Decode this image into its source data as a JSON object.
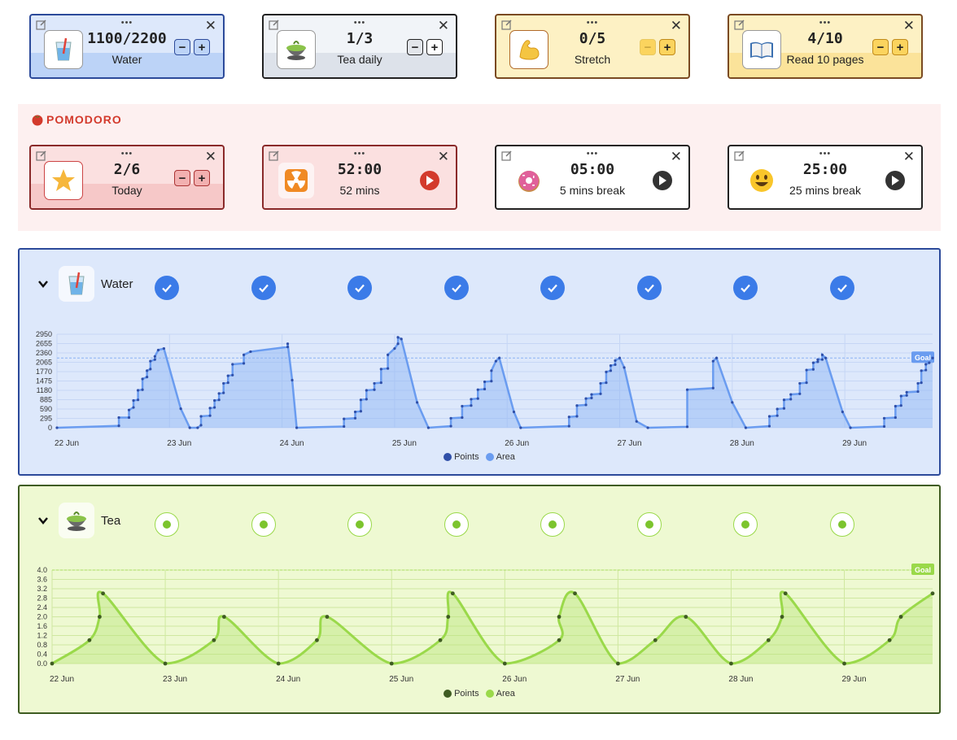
{
  "habits": [
    {
      "value": "1100/2200",
      "label": "Water",
      "icon": "water-glass-icon",
      "theme": "blue",
      "fill": 0.5
    },
    {
      "value": "1/3",
      "label": "Tea daily",
      "icon": "tea-bowl-icon",
      "theme": "gray",
      "fill": 0.33
    },
    {
      "value": "0/5",
      "label": "Stretch",
      "icon": "flexed-arm-icon",
      "theme": "yellow",
      "fill": 0
    },
    {
      "value": "4/10",
      "label": "Read 10 pages",
      "icon": "open-book-icon",
      "theme": "yellow",
      "fill": 0.4
    }
  ],
  "pomodoro": {
    "title": "POMODORO",
    "title_icon": "tomato-icon",
    "cards": [
      {
        "value": "2/6",
        "label": "Today",
        "icon": "star-icon",
        "theme": "red",
        "kind": "counter",
        "fill": 0.33
      },
      {
        "value": "52:00",
        "label": "52 mins",
        "icon": "radioactive-icon",
        "theme": "red",
        "kind": "timer"
      },
      {
        "value": "05:00",
        "label": "5 mins break",
        "icon": "donut-icon",
        "theme": "white",
        "kind": "timer"
      },
      {
        "value": "25:00",
        "label": "25 mins break",
        "icon": "smiley-icon",
        "theme": "white",
        "kind": "timer"
      }
    ]
  },
  "colors": {
    "blue_border": "#2c4a9a",
    "blue_bg": "#dde8fb",
    "blue_line": "#6a9cf0",
    "blue_point": "#2f4fa8",
    "green_border": "#3f5c22",
    "green_bg": "#eef9d2",
    "green_line": "#9ad94a",
    "green_point": "#3f5c22",
    "red": "#d33a2c"
  },
  "water_panel": {
    "name": "Water",
    "icon": "water-glass-icon",
    "day_status": [
      "done",
      "done",
      "done",
      "done",
      "done",
      "done",
      "done",
      "done"
    ],
    "goal_label": "Goal",
    "chart_data": {
      "type": "area",
      "x_tick_labels": [
        "22 Jun",
        "23 Jun",
        "24 Jun",
        "25 Jun",
        "26 Jun",
        "27 Jun",
        "28 Jun",
        "29 Jun"
      ],
      "y_tick_labels": [
        "0",
        "295",
        "590",
        "885",
        "1180",
        "1475",
        "1770",
        "2065",
        "2360",
        "2655",
        "2950"
      ],
      "ylim": [
        0,
        2950
      ],
      "xlim": [
        0,
        7.78
      ],
      "goal": 2200,
      "legend": [
        "Points",
        "Area"
      ],
      "series": [
        {
          "name": "Area",
          "points": [
            [
              0,
              0
            ],
            [
              0.55,
              60
            ],
            [
              0.55,
              320
            ],
            [
              0.64,
              320
            ],
            [
              0.64,
              560
            ],
            [
              0.68,
              640
            ],
            [
              0.68,
              860
            ],
            [
              0.72,
              880
            ],
            [
              0.72,
              1180
            ],
            [
              0.76,
              1200
            ],
            [
              0.76,
              1540
            ],
            [
              0.8,
              1600
            ],
            [
              0.8,
              1800
            ],
            [
              0.83,
              1850
            ],
            [
              0.83,
              2100
            ],
            [
              0.87,
              2150
            ],
            [
              0.87,
              2250
            ],
            [
              0.9,
              2450
            ],
            [
              0.95,
              2500
            ],
            [
              1.1,
              600
            ],
            [
              1.18,
              0
            ],
            [
              1.25,
              0
            ],
            [
              1.28,
              80
            ],
            [
              1.28,
              360
            ],
            [
              1.36,
              380
            ],
            [
              1.36,
              620
            ],
            [
              1.4,
              640
            ],
            [
              1.4,
              860
            ],
            [
              1.44,
              880
            ],
            [
              1.44,
              1080
            ],
            [
              1.48,
              1100
            ],
            [
              1.48,
              1400
            ],
            [
              1.52,
              1420
            ],
            [
              1.52,
              1640
            ],
            [
              1.56,
              1660
            ],
            [
              1.56,
              2000
            ],
            [
              1.66,
              2030
            ],
            [
              1.66,
              2300
            ],
            [
              1.72,
              2400
            ],
            [
              2.05,
              2550
            ],
            [
              2.05,
              2650
            ],
            [
              2.09,
              1500
            ],
            [
              2.13,
              0
            ],
            [
              2.55,
              40
            ],
            [
              2.55,
              280
            ],
            [
              2.65,
              300
            ],
            [
              2.65,
              500
            ],
            [
              2.7,
              520
            ],
            [
              2.7,
              880
            ],
            [
              2.75,
              900
            ],
            [
              2.75,
              1180
            ],
            [
              2.82,
              1200
            ],
            [
              2.82,
              1400
            ],
            [
              2.88,
              1420
            ],
            [
              2.88,
              1850
            ],
            [
              2.94,
              1870
            ],
            [
              2.94,
              2300
            ],
            [
              3.0,
              2500
            ],
            [
              3.03,
              2650
            ],
            [
              3.03,
              2850
            ],
            [
              3.06,
              2800
            ],
            [
              3.2,
              800
            ],
            [
              3.3,
              0
            ],
            [
              3.5,
              50
            ],
            [
              3.5,
              300
            ],
            [
              3.6,
              320
            ],
            [
              3.6,
              680
            ],
            [
              3.68,
              700
            ],
            [
              3.68,
              900
            ],
            [
              3.74,
              920
            ],
            [
              3.74,
              1200
            ],
            [
              3.8,
              1220
            ],
            [
              3.8,
              1450
            ],
            [
              3.86,
              1470
            ],
            [
              3.86,
              1800
            ],
            [
              3.9,
              2100
            ],
            [
              3.93,
              2200
            ],
            [
              4.06,
              500
            ],
            [
              4.12,
              0
            ],
            [
              4.55,
              50
            ],
            [
              4.55,
              340
            ],
            [
              4.62,
              360
            ],
            [
              4.62,
              700
            ],
            [
              4.7,
              720
            ],
            [
              4.7,
              920
            ],
            [
              4.75,
              940
            ],
            [
              4.75,
              1050
            ],
            [
              4.83,
              1070
            ],
            [
              4.83,
              1400
            ],
            [
              4.88,
              1420
            ],
            [
              4.88,
              1760
            ],
            [
              4.92,
              1800
            ],
            [
              4.92,
              1960
            ],
            [
              4.96,
              1990
            ],
            [
              4.96,
              2120
            ],
            [
              5.0,
              2200
            ],
            [
              5.04,
              1900
            ],
            [
              5.15,
              200
            ],
            [
              5.25,
              0
            ],
            [
              5.6,
              30
            ],
            [
              5.6,
              1200
            ],
            [
              5.83,
              1250
            ],
            [
              5.83,
              2100
            ],
            [
              5.86,
              2200
            ],
            [
              6.0,
              800
            ],
            [
              6.12,
              0
            ],
            [
              6.33,
              50
            ],
            [
              6.33,
              360
            ],
            [
              6.4,
              380
            ],
            [
              6.4,
              590
            ],
            [
              6.46,
              610
            ],
            [
              6.46,
              880
            ],
            [
              6.52,
              900
            ],
            [
              6.52,
              1050
            ],
            [
              6.6,
              1070
            ],
            [
              6.6,
              1400
            ],
            [
              6.66,
              1420
            ],
            [
              6.66,
              1820
            ],
            [
              6.72,
              1840
            ],
            [
              6.72,
              2050
            ],
            [
              6.76,
              2080
            ],
            [
              6.76,
              2150
            ],
            [
              6.8,
              2150
            ],
            [
              6.8,
              2300
            ],
            [
              6.83,
              2200
            ],
            [
              6.98,
              500
            ],
            [
              7.05,
              0
            ],
            [
              7.35,
              40
            ],
            [
              7.35,
              300
            ],
            [
              7.45,
              320
            ],
            [
              7.45,
              680
            ],
            [
              7.5,
              700
            ],
            [
              7.5,
              1000
            ],
            [
              7.55,
              1020
            ],
            [
              7.55,
              1120
            ],
            [
              7.65,
              1140
            ],
            [
              7.65,
              1400
            ],
            [
              7.68,
              1420
            ],
            [
              7.68,
              1800
            ],
            [
              7.72,
              1820
            ],
            [
              7.72,
              2000
            ],
            [
              7.75,
              2050
            ],
            [
              7.78,
              2200
            ]
          ]
        }
      ]
    }
  },
  "tea_panel": {
    "name": "Tea",
    "icon": "tea-bowl-icon",
    "day_status": [
      "partial",
      "partial",
      "partial",
      "partial",
      "partial",
      "partial",
      "partial",
      "partial"
    ],
    "goal_label": "Goal",
    "chart_data": {
      "type": "area",
      "x_tick_labels": [
        "22 Jun",
        "23 Jun",
        "24 Jun",
        "25 Jun",
        "26 Jun",
        "27 Jun",
        "28 Jun",
        "29 Jun"
      ],
      "y_tick_labels": [
        "0.0",
        "0.4",
        "0.8",
        "1.2",
        "1.6",
        "2.0",
        "2.4",
        "2.8",
        "3.2",
        "3.6",
        "4.0"
      ],
      "ylim": [
        0,
        4
      ],
      "xlim": [
        0,
        7.78
      ],
      "goal": 4,
      "legend": [
        "Points",
        "Area"
      ],
      "series": [
        {
          "name": "Area",
          "points": [
            [
              0,
              0
            ],
            [
              0.33,
              1
            ],
            [
              0.42,
              2
            ],
            [
              0.45,
              3
            ],
            [
              1.0,
              0
            ],
            [
              1.43,
              1
            ],
            [
              1.52,
              2
            ],
            [
              2.0,
              0
            ],
            [
              2.34,
              1
            ],
            [
              2.43,
              2
            ],
            [
              3.0,
              0
            ],
            [
              3.43,
              1
            ],
            [
              3.5,
              2
            ],
            [
              3.54,
              3
            ],
            [
              4.0,
              0
            ],
            [
              4.48,
              1
            ],
            [
              4.48,
              2
            ],
            [
              4.62,
              3
            ],
            [
              5.0,
              0
            ],
            [
              5.33,
              1
            ],
            [
              5.6,
              2
            ],
            [
              6.0,
              0
            ],
            [
              6.33,
              1
            ],
            [
              6.45,
              2
            ],
            [
              6.48,
              3
            ],
            [
              7.0,
              0
            ],
            [
              7.4,
              1
            ],
            [
              7.5,
              2
            ],
            [
              7.78,
              3
            ]
          ]
        }
      ]
    }
  }
}
